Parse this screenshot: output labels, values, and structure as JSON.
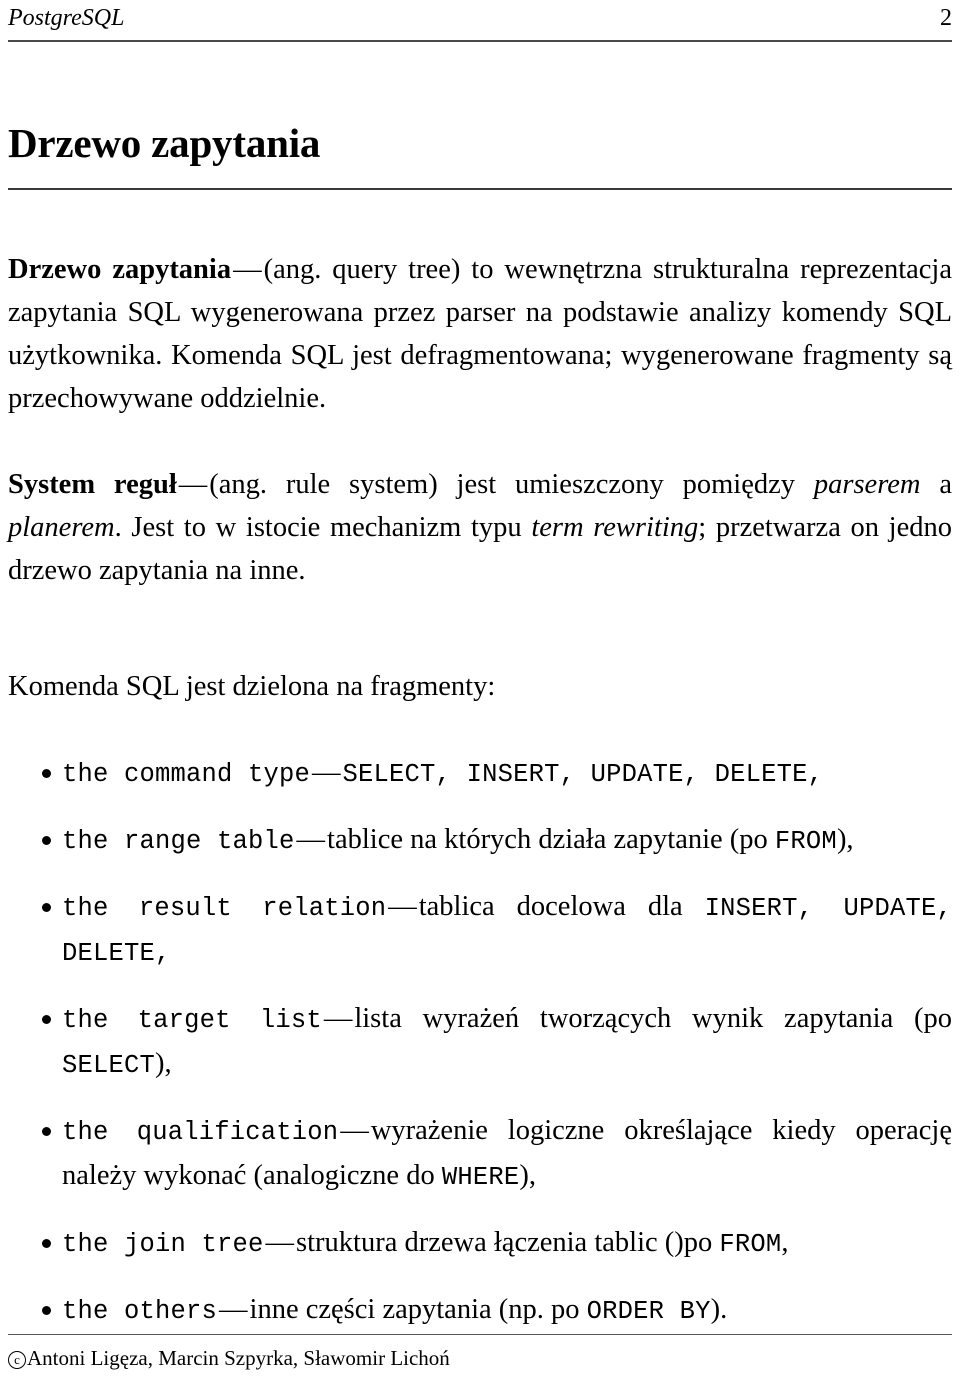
{
  "header": {
    "title": "PostgreSQL",
    "page_number": "2"
  },
  "title": {
    "heading": "Drzewo zapytania"
  },
  "paragraphs": [
    {
      "term": "Drzewo zapytania",
      "dash": "—",
      "rest_1": "(ang. query tree) to wewnętrzna strukturalna reprezentacja zapytania SQL wygenerowana przez parser na podstawie analizy komendy SQL użytkownika. Komenda SQL jest defragmentowana; wygenerowane fragmenty są przechowywane oddzielnie."
    },
    {
      "term": "System reguł",
      "dash": "—",
      "rest_1": "(ang. rule system) jest umieszczony pomiędzy ",
      "em_1": "parserem",
      "rest_2": " a ",
      "em_2": "planerem",
      "rest_3": ". Jest to w istocie mechanizm typu ",
      "em_3": "term rewriting",
      "rest_4": "; przetwarza on jedno drzewo zapytania na inne."
    }
  ],
  "list_intro": "Komenda SQL jest dzielona na fragmenty:",
  "bullets": [
    {
      "code_1": "the command type",
      "dash": "—",
      "code_2": "SELECT, INSERT, UPDATE, DELETE,",
      "text_1": ""
    },
    {
      "code_1": "the range table",
      "dash": "—",
      "text_1": "tablice na których działa zapytanie (po ",
      "code_2": "FROM",
      "text_2": "),"
    },
    {
      "code_1": "the result relation",
      "dash": "—",
      "text_1": "tablica docelowa dla ",
      "code_2": "INSERT, UPDATE, DELETE,",
      "text_2": ""
    },
    {
      "code_1": "the target list",
      "dash": "—",
      "text_1": "lista wyrażeń tworzących wynik zapytania (po ",
      "code_2": "SELECT",
      "text_2": "),"
    },
    {
      "code_1": "the qualification",
      "dash": "—",
      "text_1": "wyrażenie logiczne określające kiedy operację należy wykonać (analogiczne do ",
      "code_2": "WHERE",
      "text_2": "),"
    },
    {
      "code_1": "the join tree",
      "dash": "—",
      "text_1": "struktura drzewa łączenia tablic ()po ",
      "code_2": "FROM",
      "text_2": ","
    },
    {
      "code_1": "the others",
      "dash": "—",
      "text_1": "inne części zapytania (np. po ",
      "code_2": "ORDER BY",
      "text_2": ")."
    }
  ],
  "footer": {
    "copyright_symbol": "c",
    "authors": "Antoni Ligęza, Marcin Szpyrka, Sławomir Lichoń"
  }
}
